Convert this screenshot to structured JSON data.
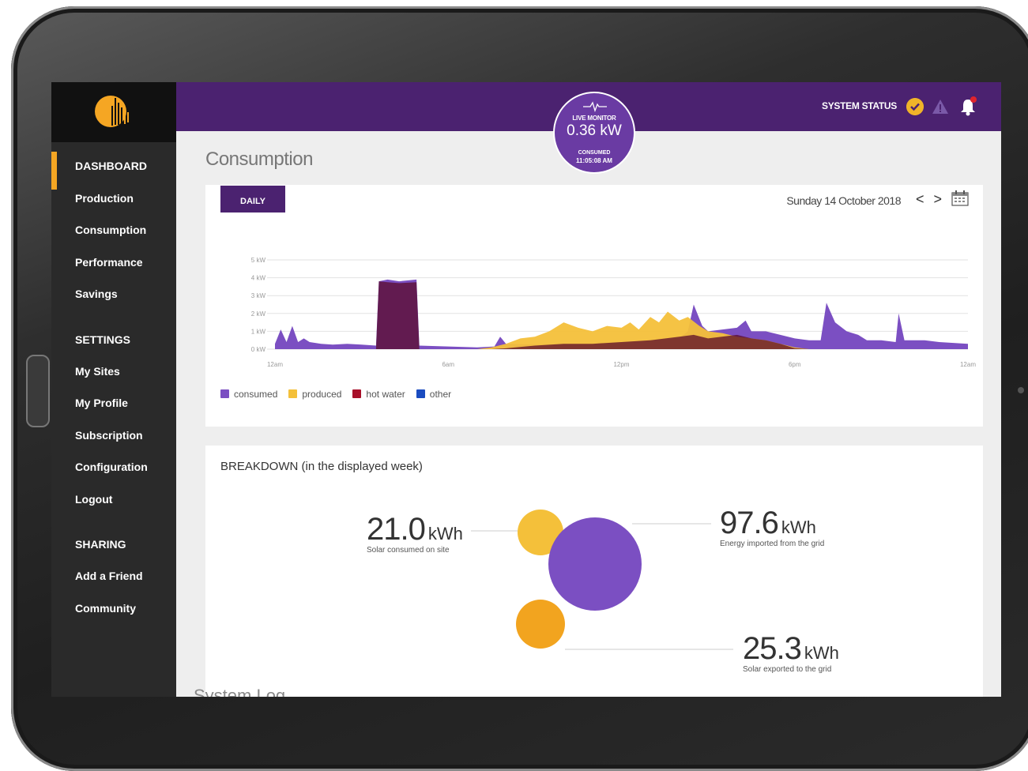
{
  "sidebar": {
    "items": [
      {
        "label": "DASHBOARD"
      },
      {
        "label": "Production"
      },
      {
        "label": "Consumption"
      },
      {
        "label": "Performance"
      },
      {
        "label": "Savings"
      }
    ],
    "settings_head": "SETTINGS",
    "settings": [
      {
        "label": "My Sites"
      },
      {
        "label": "My Profile"
      },
      {
        "label": "Subscription"
      },
      {
        "label": "Configuration"
      },
      {
        "label": "Logout"
      }
    ],
    "sharing_head": "SHARING",
    "sharing": [
      {
        "label": "Add a Friend"
      },
      {
        "label": "Community"
      }
    ]
  },
  "topbar": {
    "system_status": "SYSTEM STATUS",
    "live_label": "LIVE MONITOR",
    "live_value": "0.36 kW",
    "live_sub": "CONSUMED",
    "live_time": "11:05:08 AM"
  },
  "page": {
    "title": "Consumption"
  },
  "daily_card": {
    "tab": "DAILY",
    "date": "Sunday 14 October 2018",
    "prev": "<",
    "next": ">"
  },
  "chart_data": {
    "type": "area",
    "y_ticks": [
      "5 kW",
      "4 kW",
      "3 kW",
      "2 kW",
      "1 kW",
      "0 kW"
    ],
    "ylim": [
      0,
      5
    ],
    "x_ticks": [
      "12am",
      "6am",
      "12pm",
      "6pm",
      "12am"
    ],
    "xlim": [
      0,
      24
    ],
    "grid": true,
    "legend_position": "bottom-left",
    "series": [
      {
        "name": "consumed",
        "color": "#7b4fc2",
        "points": [
          [
            0,
            0.3
          ],
          [
            0.2,
            1.1
          ],
          [
            0.4,
            0.4
          ],
          [
            0.6,
            1.3
          ],
          [
            0.8,
            0.4
          ],
          [
            1.0,
            0.6
          ],
          [
            1.2,
            0.4
          ],
          [
            1.6,
            0.3
          ],
          [
            2.0,
            0.25
          ],
          [
            2.5,
            0.3
          ],
          [
            3.0,
            0.25
          ],
          [
            3.5,
            0.2
          ],
          [
            3.6,
            3.8
          ],
          [
            3.9,
            3.9
          ],
          [
            4.3,
            3.8
          ],
          [
            4.9,
            3.9
          ],
          [
            5.0,
            0.2
          ],
          [
            6.0,
            0.15
          ],
          [
            7.0,
            0.1
          ],
          [
            7.6,
            0.15
          ],
          [
            7.8,
            0.7
          ],
          [
            8.0,
            0.3
          ],
          [
            9.0,
            0.25
          ],
          [
            10.0,
            0.3
          ],
          [
            11.0,
            0.3
          ],
          [
            12.0,
            0.4
          ],
          [
            13.0,
            0.5
          ],
          [
            14.0,
            0.6
          ],
          [
            14.3,
            1.0
          ],
          [
            14.5,
            2.5
          ],
          [
            14.8,
            1.3
          ],
          [
            15.0,
            1.0
          ],
          [
            15.5,
            1.1
          ],
          [
            16.0,
            1.2
          ],
          [
            16.3,
            1.6
          ],
          [
            16.5,
            1.0
          ],
          [
            17.0,
            1.0
          ],
          [
            17.5,
            0.8
          ],
          [
            18.0,
            0.6
          ],
          [
            18.5,
            0.5
          ],
          [
            18.9,
            0.5
          ],
          [
            19.1,
            2.6
          ],
          [
            19.4,
            1.5
          ],
          [
            19.8,
            1.0
          ],
          [
            20.2,
            0.8
          ],
          [
            20.5,
            0.5
          ],
          [
            21.0,
            0.5
          ],
          [
            21.5,
            0.4
          ],
          [
            21.6,
            2.0
          ],
          [
            21.8,
            0.5
          ],
          [
            22.5,
            0.5
          ],
          [
            23.0,
            0.4
          ],
          [
            23.5,
            0.35
          ],
          [
            24,
            0.3
          ]
        ]
      },
      {
        "name": "produced",
        "color": "#f4c03a",
        "points": [
          [
            7.0,
            0
          ],
          [
            7.5,
            0.1
          ],
          [
            8.0,
            0.3
          ],
          [
            8.5,
            0.6
          ],
          [
            9.0,
            0.7
          ],
          [
            9.5,
            1.0
          ],
          [
            10.0,
            1.5
          ],
          [
            10.5,
            1.2
          ],
          [
            11.0,
            1.0
          ],
          [
            11.5,
            1.3
          ],
          [
            12.0,
            1.2
          ],
          [
            12.3,
            1.5
          ],
          [
            12.6,
            1.1
          ],
          [
            13.0,
            1.8
          ],
          [
            13.3,
            1.5
          ],
          [
            13.6,
            2.1
          ],
          [
            14.0,
            1.6
          ],
          [
            14.3,
            1.8
          ],
          [
            14.7,
            1.3
          ],
          [
            15.0,
            1.0
          ],
          [
            15.5,
            0.9
          ],
          [
            16.0,
            0.7
          ],
          [
            16.5,
            0.6
          ],
          [
            17.0,
            0.5
          ],
          [
            17.5,
            0.3
          ],
          [
            18.0,
            0.1
          ],
          [
            18.5,
            0
          ]
        ]
      },
      {
        "name": "hot water",
        "color": "#5a0a2a",
        "points": [
          [
            3.5,
            0
          ],
          [
            3.6,
            3.8
          ],
          [
            3.9,
            3.75
          ],
          [
            4.3,
            3.7
          ],
          [
            4.9,
            3.75
          ],
          [
            5.0,
            0
          ],
          [
            7.5,
            0
          ],
          [
            8.0,
            0.05
          ],
          [
            9.0,
            0.2
          ],
          [
            10.0,
            0.3
          ],
          [
            11.0,
            0.3
          ],
          [
            12.0,
            0.4
          ],
          [
            13.0,
            0.5
          ],
          [
            14.0,
            0.7
          ],
          [
            14.5,
            0.8
          ],
          [
            15.0,
            0.6
          ],
          [
            16.0,
            0.8
          ],
          [
            16.5,
            0.6
          ],
          [
            17.0,
            0.5
          ],
          [
            17.5,
            0.3
          ],
          [
            18.0,
            0.05
          ],
          [
            18.5,
            0
          ]
        ]
      },
      {
        "name": "other",
        "color": "#1a4cc0",
        "points": []
      }
    ]
  },
  "breakdown": {
    "title": "BREAKDOWN (in the displayed week)",
    "solar_consumed": {
      "value": "21.0",
      "unit": "kWh",
      "desc": "Solar consumed on site"
    },
    "imported": {
      "value": "97.6",
      "unit": "kWh",
      "desc": "Energy imported from the grid"
    },
    "exported": {
      "value": "25.3",
      "unit": "kWh",
      "desc": "Solar exported to the grid"
    },
    "colors": {
      "solar": "#f4c03a",
      "grid": "#7b4fc2",
      "export": "#f2a41f"
    }
  },
  "footer": {
    "system_log": "System Log"
  }
}
